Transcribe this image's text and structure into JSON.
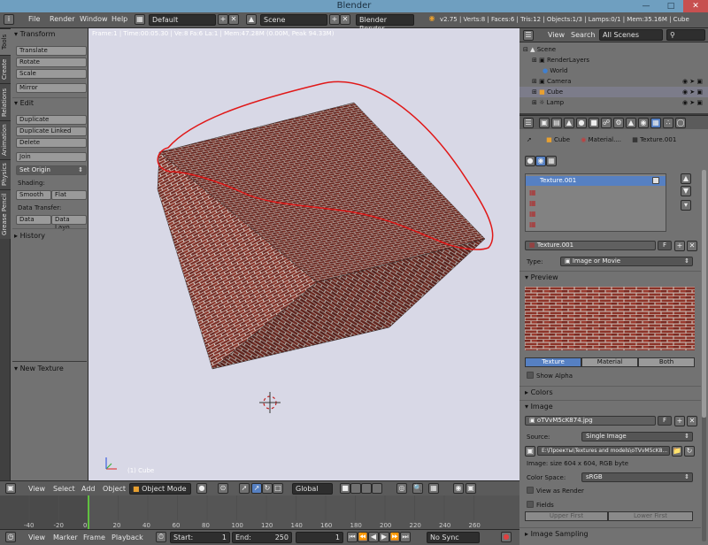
{
  "window": {
    "title": "Blender"
  },
  "topbar": {
    "menus": [
      "File",
      "Render",
      "Window",
      "Help"
    ],
    "layout": "Default",
    "scene": "Scene",
    "engine": "Blender Render",
    "stats": "v2.75 | Verts:8 | Faces:6 | Tris:12 | Objects:1/3 | Lamps:0/1 | Mem:35.16M | Cube"
  },
  "tool_tabs": [
    "Tools",
    "Create",
    "Relations",
    "Animation",
    "Physics",
    "Grease Pencil"
  ],
  "tool_shelf": {
    "transform_header": "Transform",
    "translate": "Translate",
    "rotate": "Rotate",
    "scale": "Scale",
    "mirror": "Mirror",
    "edit_header": "Edit",
    "duplicate": "Duplicate",
    "duplicate_linked": "Duplicate Linked",
    "delete": "Delete",
    "join": "Join",
    "set_origin": "Set Origin",
    "shading_label": "Shading:",
    "smooth": "Smooth",
    "flat": "Flat",
    "data_transfer_label": "Data Transfer:",
    "data": "Data",
    "data_layout": "Data Layo",
    "history_header": "History",
    "new_texture_header": "New Texture"
  },
  "viewport": {
    "info": "Frame:1 | Time:00:05.30 | Ve:8 Fa:6 La:1 | Mem:47.28M (0.00M, Peak 94.33M)",
    "object_label": "(1) Cube"
  },
  "viewport_header": {
    "menus": [
      "View",
      "Select",
      "Add",
      "Object"
    ],
    "mode": "Object Mode",
    "orientation": "Global"
  },
  "timeline": {
    "ticks": [
      "-40",
      "-20",
      "0",
      "20",
      "40",
      "60",
      "80",
      "100",
      "120",
      "140",
      "160",
      "180",
      "200",
      "220",
      "240",
      "260"
    ],
    "menus": [
      "View",
      "Marker",
      "Frame",
      "Playback"
    ],
    "start_label": "Start:",
    "start": "1",
    "end_label": "End:",
    "end": "250",
    "current": "1",
    "sync": "No Sync"
  },
  "outliner": {
    "menus": [
      "View",
      "Search"
    ],
    "filter": "All Scenes",
    "items": [
      {
        "label": "Scene"
      },
      {
        "label": "RenderLayers"
      },
      {
        "label": "World"
      },
      {
        "label": "Camera"
      },
      {
        "label": "Cube"
      },
      {
        "label": "Lamp"
      }
    ]
  },
  "properties": {
    "breadcrumb": [
      "Cube",
      "Material....",
      "Texture.001"
    ],
    "texture_slots": [
      "Texture.001"
    ],
    "texture_name": "Texture.001",
    "type_label": "Type:",
    "type_value": "Image or Movie",
    "preview_header": "Preview",
    "preview_tabs": [
      "Texture",
      "Material",
      "Both"
    ],
    "show_alpha": "Show Alpha",
    "colors_header": "Colors",
    "image_header": "Image",
    "image_name": "oTVvM5cK874.jpg",
    "source_label": "Source:",
    "source_value": "Single Image",
    "filepath": "E:\\Проекты\\Textures and models\\oTVvM5cK8...",
    "image_info": "Image: size 604 x 604, RGB byte",
    "color_space_label": "Color Space:",
    "color_space_value": "sRGB",
    "view_as_render": "View as Render",
    "fields": "Fields",
    "field_order": [
      "Upper First",
      "Lower First"
    ],
    "image_sampling_header": "Image Sampling",
    "f_label": "F"
  },
  "colors": {
    "titlebar": "#6f9fc0",
    "viewport_bg": "#d8d8e6",
    "selection": "#5680c2",
    "annotation": "#e01818",
    "brick": "#7a2c24"
  }
}
